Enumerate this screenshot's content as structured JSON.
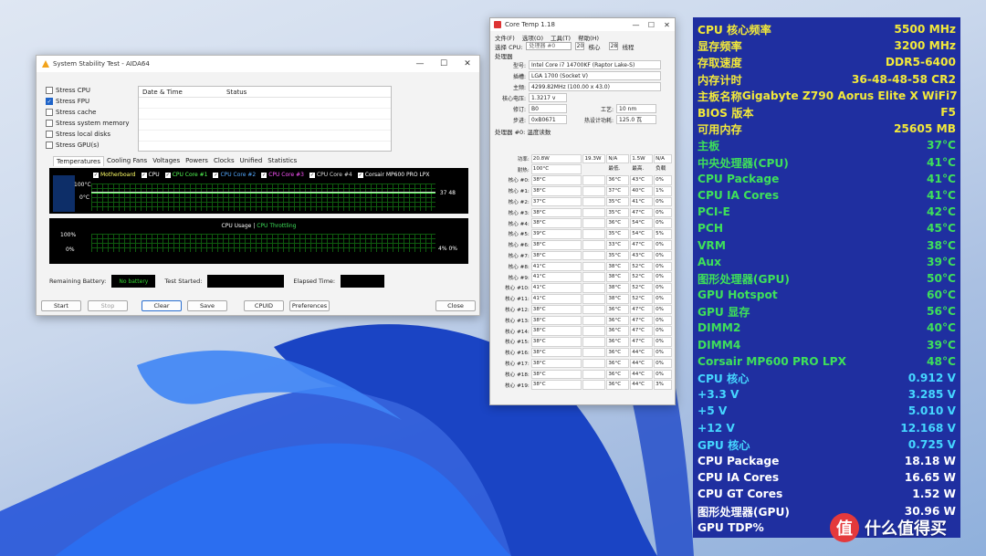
{
  "aida": {
    "title": "System Stability Test - AIDA64",
    "stress_items": [
      {
        "label": "Stress CPU",
        "checked": false
      },
      {
        "label": "Stress FPU",
        "checked": true
      },
      {
        "label": "Stress cache",
        "checked": false
      },
      {
        "label": "Stress system memory",
        "checked": false
      },
      {
        "label": "Stress local disks",
        "checked": false
      },
      {
        "label": "Stress GPU(s)",
        "checked": false
      }
    ],
    "log_headers": [
      "Date & Time",
      "Status"
    ],
    "tabs": [
      "Temperatures",
      "Cooling Fans",
      "Voltages",
      "Powers",
      "Clocks",
      "Unified",
      "Statistics"
    ],
    "temp_legend": [
      {
        "label": "Motherboard",
        "color": "#ffff66"
      },
      {
        "label": "CPU",
        "color": "#ffffff"
      },
      {
        "label": "CPU Core #1",
        "color": "#55ff55"
      },
      {
        "label": "CPU Core #2",
        "color": "#55aaff"
      },
      {
        "label": "CPU Core #3",
        "color": "#ff55ff"
      },
      {
        "label": "CPU Core #4",
        "color": "#dddddd"
      },
      {
        "label": "Corsair MP600 PRO LPX",
        "color": "#ffffff"
      }
    ],
    "temp_axis_top": "100°C",
    "temp_axis_bottom": "0°C",
    "temp_current": "37 48",
    "usage_legend_left": "CPU Usage",
    "usage_legend_sep": "|",
    "usage_legend_right": "CPU Throttling",
    "usage_axis_top": "100%",
    "usage_axis_bottom": "0%",
    "usage_current": "4% 0%",
    "remaining_battery_label": "Remaining Battery:",
    "remaining_battery_value": "No battery",
    "test_started_label": "Test Started:",
    "elapsed_time_label": "Elapsed Time:",
    "buttons": {
      "start": "Start",
      "stop": "Stop",
      "clear": "Clear",
      "save": "Save",
      "cpuid": "CPUID",
      "preferences": "Preferences",
      "close": "Close"
    }
  },
  "coretemp": {
    "title": "Core Temp 1.18",
    "menu": [
      "文件(F)",
      "选项(O)",
      "工具(T)",
      "帮助(H)"
    ],
    "select_label": "选择 CPU:",
    "select_value": "处理器 #0",
    "cores_count": "20",
    "cores_label": "核心",
    "threads_count": "28",
    "threads_label": "线程",
    "processor_group": "处理器",
    "fields": {
      "model_label": "型号:",
      "model": "Intel Core i7 14700KF (Raptor Lake-S)",
      "platform_label": "插槽:",
      "platform": "LGA 1700 (Socket V)",
      "freq_label": "主频:",
      "freq": "4299.82MHz (100.00 x 43.0)",
      "vid_label": "核心电压:",
      "vid": "1.3217 v",
      "rev_label": "修订:",
      "rev": "B0",
      "lith_label": "工艺:",
      "lith": "10 nm",
      "cpuid_label": "步进:",
      "cpuid": "0xB0671",
      "tdp_label": "热设计功耗:",
      "tdp": "125.0 瓦"
    },
    "readings_title": "处理器 #0: 温度读数",
    "power_label": "功率:",
    "power_values": [
      "20.8W",
      "19.3W",
      "N/A",
      "1.5W",
      "N/A"
    ],
    "tjmax_label": "耐热:",
    "tjmax_value": "100°C",
    "col_min": "最低.",
    "col_max": "最高.",
    "col_load": "负载",
    "cores": [
      {
        "label": "核心 #0:",
        "temp": "38°C",
        "min": "36°C",
        "max": "43°C",
        "load": "0%"
      },
      {
        "label": "核心 #1:",
        "temp": "38°C",
        "min": "37°C",
        "max": "40°C",
        "load": "1%"
      },
      {
        "label": "核心 #2:",
        "temp": "37°C",
        "min": "35°C",
        "max": "41°C",
        "load": "0%"
      },
      {
        "label": "核心 #3:",
        "temp": "38°C",
        "min": "35°C",
        "max": "47°C",
        "load": "0%"
      },
      {
        "label": "核心 #4:",
        "temp": "38°C",
        "min": "36°C",
        "max": "54°C",
        "load": "0%"
      },
      {
        "label": "核心 #5:",
        "temp": "39°C",
        "min": "35°C",
        "max": "54°C",
        "load": "5%"
      },
      {
        "label": "核心 #6:",
        "temp": "38°C",
        "min": "33°C",
        "max": "47°C",
        "load": "0%"
      },
      {
        "label": "核心 #7:",
        "temp": "38°C",
        "min": "35°C",
        "max": "43°C",
        "load": "0%"
      },
      {
        "label": "核心 #8:",
        "temp": "41°C",
        "min": "38°C",
        "max": "52°C",
        "load": "0%"
      },
      {
        "label": "核心 #9:",
        "temp": "41°C",
        "min": "38°C",
        "max": "52°C",
        "load": "0%"
      },
      {
        "label": "核心 #10:",
        "temp": "41°C",
        "min": "38°C",
        "max": "52°C",
        "load": "0%"
      },
      {
        "label": "核心 #11:",
        "temp": "41°C",
        "min": "38°C",
        "max": "52°C",
        "load": "0%"
      },
      {
        "label": "核心 #12:",
        "temp": "38°C",
        "min": "36°C",
        "max": "47°C",
        "load": "0%"
      },
      {
        "label": "核心 #13:",
        "temp": "38°C",
        "min": "36°C",
        "max": "47°C",
        "load": "0%"
      },
      {
        "label": "核心 #14:",
        "temp": "38°C",
        "min": "36°C",
        "max": "47°C",
        "load": "0%"
      },
      {
        "label": "核心 #15:",
        "temp": "38°C",
        "min": "36°C",
        "max": "47°C",
        "load": "0%"
      },
      {
        "label": "核心 #16:",
        "temp": "38°C",
        "min": "36°C",
        "max": "44°C",
        "load": "0%"
      },
      {
        "label": "核心 #17:",
        "temp": "38°C",
        "min": "36°C",
        "max": "44°C",
        "load": "0%"
      },
      {
        "label": "核心 #18:",
        "temp": "38°C",
        "min": "36°C",
        "max": "44°C",
        "load": "0%"
      },
      {
        "label": "核心 #19:",
        "temp": "38°C",
        "min": "36°C",
        "max": "44°C",
        "load": "3%"
      }
    ]
  },
  "hwinfo": {
    "rows": [
      {
        "label": "CPU 核心频率",
        "value": "5500 MHz",
        "tone": "y"
      },
      {
        "label": "显存频率",
        "value": "3200 MHz",
        "tone": "y"
      },
      {
        "label": "存取速度",
        "value": "DDR5-6400",
        "tone": "y"
      },
      {
        "label": "内存计时",
        "value": "36-48-48-58 CR2",
        "tone": "y"
      },
      {
        "label": "主板名称",
        "value": "Gigabyte Z790 Aorus Elite X WiFi7",
        "tone": "y"
      },
      {
        "label": "BIOS 版本",
        "value": "F5",
        "tone": "y"
      },
      {
        "label": "可用内存",
        "value": "25605 MB",
        "tone": "y"
      },
      {
        "label": "主板",
        "value": "37°C",
        "tone": "g"
      },
      {
        "label": "中央处理器(CPU)",
        "value": "41°C",
        "tone": "g"
      },
      {
        "label": "CPU Package",
        "value": "41°C",
        "tone": "g"
      },
      {
        "label": "CPU IA Cores",
        "value": "41°C",
        "tone": "g"
      },
      {
        "label": "PCI-E",
        "value": "42°C",
        "tone": "g"
      },
      {
        "label": "PCH",
        "value": "45°C",
        "tone": "g"
      },
      {
        "label": "VRM",
        "value": "38°C",
        "tone": "g"
      },
      {
        "label": "Aux",
        "value": "39°C",
        "tone": "g"
      },
      {
        "label": "图形处理器(GPU)",
        "value": "50°C",
        "tone": "g"
      },
      {
        "label": "GPU Hotspot",
        "value": "60°C",
        "tone": "g"
      },
      {
        "label": "GPU 显存",
        "value": "56°C",
        "tone": "g"
      },
      {
        "label": "DIMM2",
        "value": "40°C",
        "tone": "g"
      },
      {
        "label": "DIMM4",
        "value": "39°C",
        "tone": "g"
      },
      {
        "label": "Corsair MP600 PRO LPX",
        "value": "48°C",
        "tone": "g"
      },
      {
        "label": "CPU 核心",
        "value": "0.912 V",
        "tone": "c"
      },
      {
        "label": "+3.3 V",
        "value": "3.285 V",
        "tone": "c"
      },
      {
        "label": "+5 V",
        "value": "5.010 V",
        "tone": "c"
      },
      {
        "label": "+12 V",
        "value": "12.168 V",
        "tone": "c"
      },
      {
        "label": "GPU 核心",
        "value": "0.725 V",
        "tone": "c"
      },
      {
        "label": "CPU Package",
        "value": "18.18 W",
        "tone": "w"
      },
      {
        "label": "CPU IA Cores",
        "value": "16.65 W",
        "tone": "w"
      },
      {
        "label": "CPU GT Cores",
        "value": "1.52 W",
        "tone": "w"
      },
      {
        "label": "图形处理器(GPU)",
        "value": "30.96 W",
        "tone": "w"
      },
      {
        "label": "GPU TDP%",
        "value": "",
        "tone": "w"
      }
    ]
  },
  "watermark": {
    "badge": "值",
    "text": "什么值得买"
  }
}
